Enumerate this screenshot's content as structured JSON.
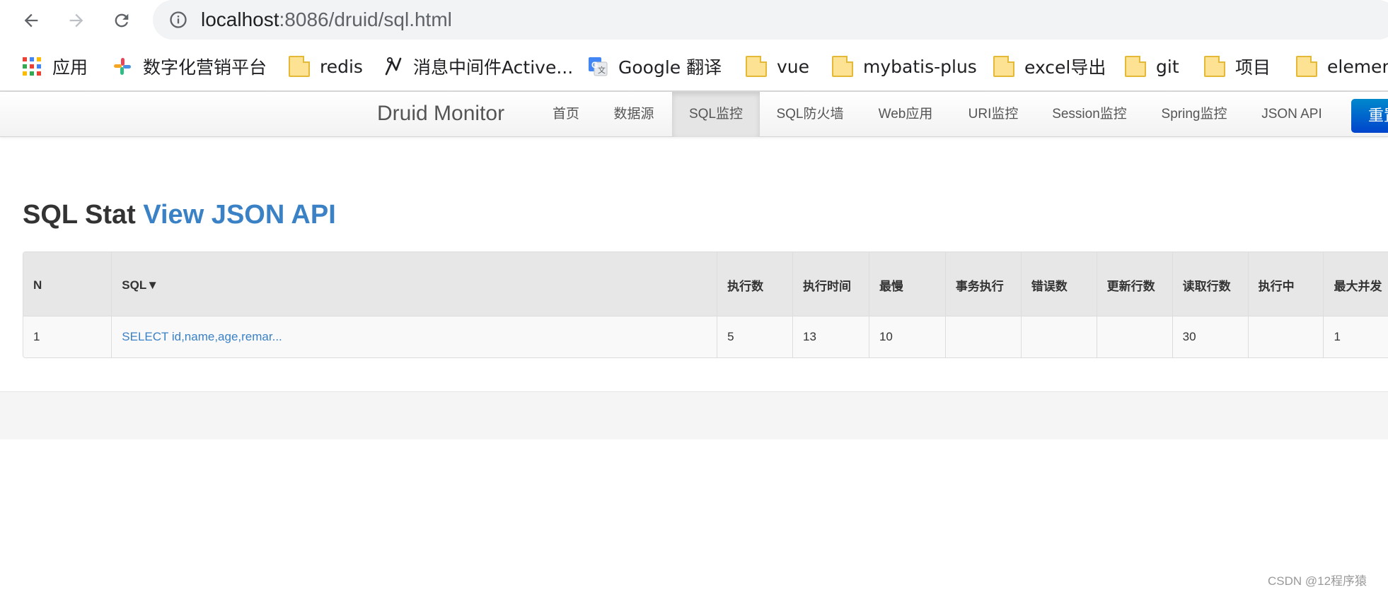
{
  "browser": {
    "url_host": "localhost",
    "url_path": ":8086/druid/sql.html"
  },
  "bookmarks": [
    {
      "label": "应用",
      "icon": "apps-grid-icon"
    },
    {
      "label": "数字化营销平台",
      "icon": "colorful-pinwheel-icon"
    },
    {
      "label": "redis",
      "icon": "folder-icon"
    },
    {
      "label": "消息中间件Active...",
      "icon": "activemq-feather-icon"
    },
    {
      "label": "Google 翻译",
      "icon": "google-translate-icon"
    },
    {
      "label": "vue",
      "icon": "folder-icon"
    },
    {
      "label": "mybatis-plus",
      "icon": "folder-icon"
    },
    {
      "label": "excel导出",
      "icon": "folder-icon"
    },
    {
      "label": "git",
      "icon": "folder-icon"
    },
    {
      "label": "项目",
      "icon": "folder-icon"
    },
    {
      "label": "element",
      "icon": "folder-icon"
    }
  ],
  "navbar": {
    "brand": "Druid Monitor",
    "items": [
      "首页",
      "数据源",
      "SQL监控",
      "SQL防火墙",
      "Web应用",
      "URI监控",
      "Session监控",
      "Spring监控",
      "JSON API"
    ],
    "active": "SQL监控",
    "reset_label": "重置"
  },
  "heading": {
    "title": "SQL Stat",
    "link": "View JSON API"
  },
  "table": {
    "headers": [
      "N",
      "SQL▼",
      "执行数",
      "执行时间",
      "最慢",
      "事务执行",
      "错误数",
      "更新行数",
      "读取行数",
      "执行中",
      "最大并发"
    ],
    "rows": [
      [
        "1",
        "SELECT id,name,age,remar...",
        "5",
        "13",
        "10",
        "",
        "",
        "",
        "30",
        "",
        "1"
      ]
    ]
  },
  "watermark": "CSDN @12程序猿"
}
